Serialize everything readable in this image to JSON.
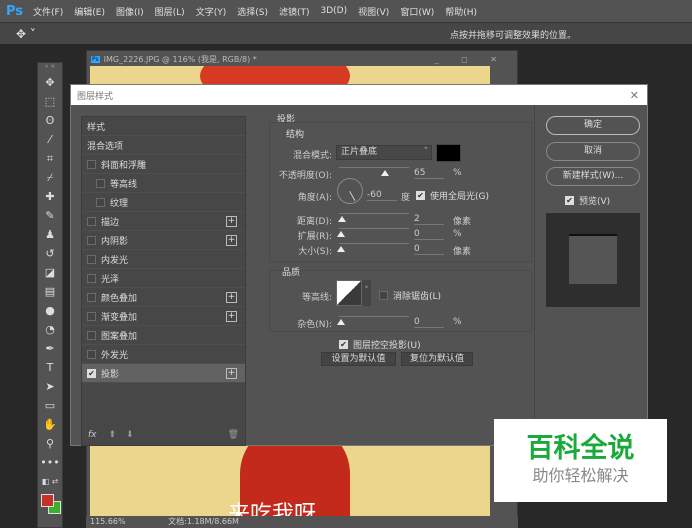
{
  "menubar": {
    "logo": "Ps",
    "items": [
      "文件(F)",
      "编辑(E)",
      "图像(I)",
      "图层(L)",
      "文字(Y)",
      "选择(S)",
      "滤镜(T)",
      "3D(D)",
      "视图(V)",
      "窗口(W)",
      "帮助(H)"
    ]
  },
  "optbar": {
    "hint": "点按并拖移可调整效果的位置。"
  },
  "document": {
    "title": "IMG_2226.JPG @ 116% (我是, RGB/8) *",
    "canvas_text": "来吃我呀",
    "zoom": "115.66%",
    "doc_size": "文档:1.18M/8.66M"
  },
  "dialog": {
    "title": "图层样式",
    "styles": [
      {
        "label": "样式",
        "cb": null,
        "plus": false
      },
      {
        "label": "混合选项",
        "cb": null,
        "plus": false
      },
      {
        "label": "斜面和浮雕",
        "cb": false,
        "plus": false
      },
      {
        "label": "等高线",
        "cb": false,
        "plus": false,
        "indent": true
      },
      {
        "label": "纹理",
        "cb": false,
        "plus": false,
        "indent": true
      },
      {
        "label": "描边",
        "cb": false,
        "plus": true
      },
      {
        "label": "内阴影",
        "cb": false,
        "plus": true
      },
      {
        "label": "内发光",
        "cb": false,
        "plus": false
      },
      {
        "label": "光泽",
        "cb": false,
        "plus": false
      },
      {
        "label": "颜色叠加",
        "cb": false,
        "plus": true
      },
      {
        "label": "渐变叠加",
        "cb": false,
        "plus": true
      },
      {
        "label": "图案叠加",
        "cb": false,
        "plus": false
      },
      {
        "label": "外发光",
        "cb": false,
        "plus": false
      },
      {
        "label": "投影",
        "cb": true,
        "plus": true,
        "selected": true
      }
    ],
    "footer": {
      "fx": "fx"
    },
    "panel": {
      "title": "投影",
      "structure": "结构",
      "blend_label": "混合模式:",
      "blend_value": "正片叠底",
      "shadow_color": "#000000",
      "opacity_label": "不透明度(O):",
      "opacity": "65",
      "opacity_unit": "%",
      "angle_label": "角度(A):",
      "angle": "-60",
      "angle_unit": "度",
      "global_light": "使用全局光(G)",
      "distance_label": "距离(D):",
      "distance": "2",
      "distance_unit": "像素",
      "spread_label": "扩展(R):",
      "spread": "0",
      "spread_unit": "%",
      "size_label": "大小(S):",
      "size": "0",
      "size_unit": "像素",
      "quality": "品质",
      "contour_label": "等高线:",
      "antialias": "消除锯齿(L)",
      "noise_label": "杂色(N):",
      "noise": "0",
      "noise_unit": "%",
      "knockout": "图层挖空投影(U)",
      "set_default": "设置为默认值",
      "reset_default": "复位为默认值"
    },
    "buttons": {
      "ok": "确定",
      "cancel": "取消",
      "new_style": "新建样式(W)...",
      "preview": "预览(V)"
    }
  },
  "watermark": {
    "title": "百科全说",
    "subtitle": "助你轻松解决"
  },
  "colors": {
    "fg": "#c8302a",
    "bg": "#3cae30"
  }
}
